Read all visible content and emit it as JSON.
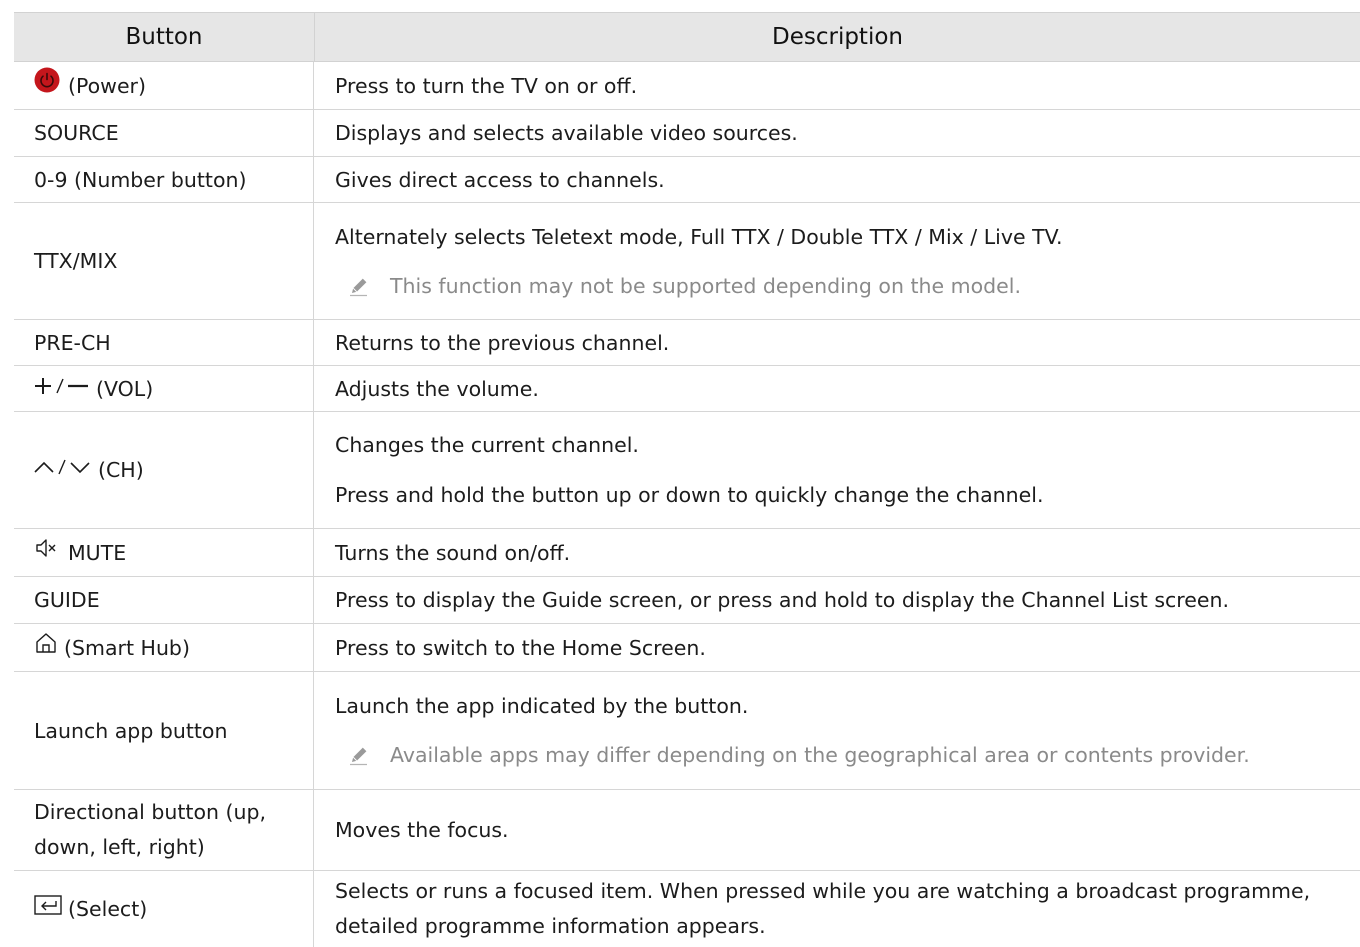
{
  "header": {
    "button": "Button",
    "description": "Description"
  },
  "rows": [
    {
      "icon": "power-icon",
      "button": "(Power)",
      "desc": [
        "Press to turn the TV on or off."
      ]
    },
    {
      "button": "SOURCE",
      "desc": [
        "Displays and selects available video sources."
      ]
    },
    {
      "button": "0-9 (Number button)",
      "desc": [
        "Gives direct access to channels."
      ]
    },
    {
      "button": "TTX/MIX",
      "desc": [
        "Alternately selects Teletext mode, Full TTX / Double TTX / Mix / Live TV."
      ],
      "note": "This function may not be supported depending on the model."
    },
    {
      "button": "PRE-CH",
      "desc": [
        "Returns to the previous channel."
      ]
    },
    {
      "icon": "plus-minus-icon",
      "button": "(VOL)",
      "desc": [
        "Adjusts the volume."
      ]
    },
    {
      "icon": "up-down-chevron-icon",
      "button": "(CH)",
      "desc": [
        "Changes the current channel.",
        "Press and hold the button up or down to quickly change the channel."
      ]
    },
    {
      "icon": "mute-icon",
      "button": "MUTE",
      "desc": [
        "Turns the sound on/off."
      ]
    },
    {
      "button": "GUIDE",
      "desc": [
        "Press to display the Guide screen, or press and hold to display the Channel List screen."
      ]
    },
    {
      "icon": "home-icon",
      "button": "(Smart Hub)",
      "desc": [
        "Press to switch to the Home Screen."
      ]
    },
    {
      "button": "Launch app button",
      "desc": [
        "Launch the app indicated by the button."
      ],
      "note": "Available apps may differ depending on the geographical area or contents provider."
    },
    {
      "button": "Directional button (up, down, left, right)",
      "desc": [
        "Moves the focus."
      ]
    },
    {
      "icon": "select-icon",
      "button": "(Select)",
      "desc": [
        "Selects or runs a focused item. When pressed while you are watching a broadcast programme, detailed programme information appears."
      ]
    }
  ]
}
